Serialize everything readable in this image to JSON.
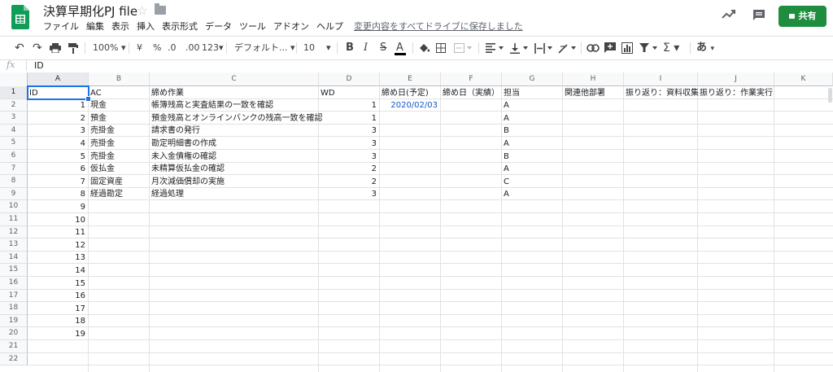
{
  "app": {
    "title": "決算早期化PJ file",
    "menus": [
      "ファイル",
      "編集",
      "表示",
      "挿入",
      "表示形式",
      "データ",
      "ツール",
      "アドオン",
      "ヘルプ"
    ],
    "save_status": "変更内容をすべてドライブに保存しました",
    "share_label": "共有",
    "brand_color": "#0f9d58",
    "share_color": "#1e8e3e"
  },
  "toolbar": {
    "zoom": "100%",
    "currency": "¥",
    "percent": "%",
    "decimal_decrease": ".0",
    "decimal_increase": ".00",
    "more_formats": "123",
    "font": "デフォルト...",
    "font_size": "10",
    "bold": "B",
    "italic": "I",
    "strike": "S",
    "text_color": "A",
    "input_tool": "あ"
  },
  "formula_bar": {
    "fx": "fx",
    "value": "ID"
  },
  "sheet": {
    "column_letters": [
      "A",
      "B",
      "C",
      "D",
      "E",
      "F",
      "G",
      "H",
      "I",
      "J",
      "K"
    ],
    "row_numbers": [
      "1",
      "2",
      "3",
      "4",
      "5",
      "6",
      "7",
      "8",
      "9",
      "10",
      "11",
      "12",
      "13",
      "14",
      "15",
      "16",
      "17",
      "18",
      "19",
      "20",
      "21",
      "22"
    ],
    "headers": [
      "ID",
      "AC",
      "締め作業",
      "WD",
      "締め日(予定)",
      "締め日（実績）",
      "担当",
      "関連他部署",
      "振り返り：資料収集",
      "振り返り：作業実行"
    ],
    "rows": [
      [
        "1",
        "現金",
        "帳簿残高と実査結果の一致を確認",
        "1",
        "2020/02/03",
        "",
        "A"
      ],
      [
        "2",
        "預金",
        "預金残高とオンラインバンクの残高一致を確認",
        "1",
        "",
        "",
        "A"
      ],
      [
        "3",
        "売掛金",
        "請求書の発行",
        "3",
        "",
        "",
        "B"
      ],
      [
        "4",
        "売掛金",
        "勘定明細書の作成",
        "3",
        "",
        "",
        "A"
      ],
      [
        "5",
        "売掛金",
        "未入金債権の確認",
        "3",
        "",
        "",
        "B"
      ],
      [
        "6",
        "仮払金",
        "未精算仮払金の確認",
        "2",
        "",
        "",
        "A"
      ],
      [
        "7",
        "固定資産",
        "月次減価償却の実施",
        "2",
        "",
        "",
        "C"
      ],
      [
        "8",
        "経過勘定",
        "経過処理",
        "3",
        "",
        "",
        "A"
      ]
    ],
    "extra_ids": [
      "9",
      "10",
      "11",
      "12",
      "13",
      "14",
      "15",
      "16",
      "17",
      "18",
      "19"
    ],
    "date_color": "#1155cc"
  }
}
